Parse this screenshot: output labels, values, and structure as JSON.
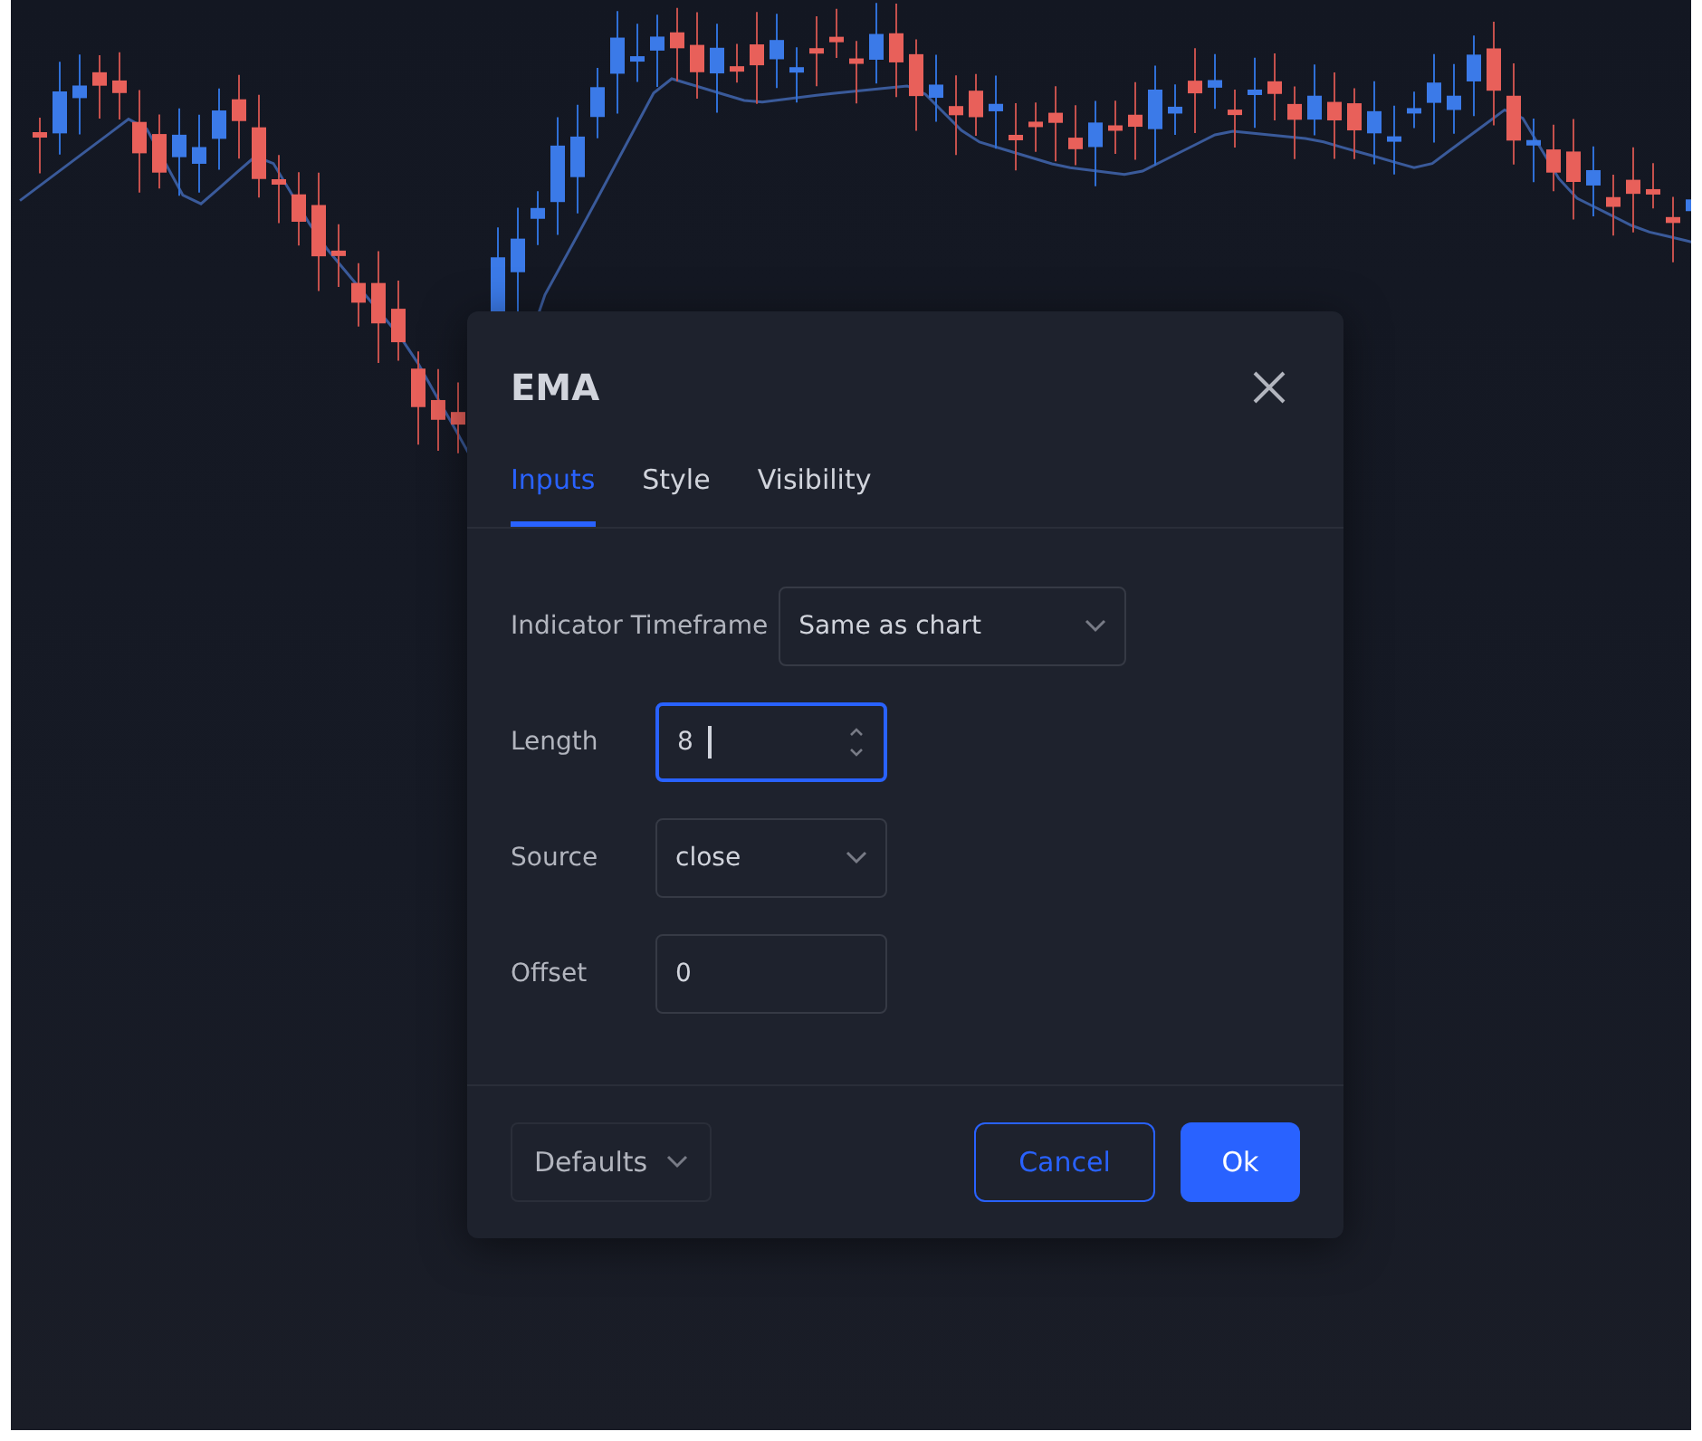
{
  "dialog": {
    "title": "EMA",
    "tabs": [
      {
        "label": "Inputs",
        "selected": true
      },
      {
        "label": "Style",
        "selected": false
      },
      {
        "label": "Visibility",
        "selected": false
      }
    ],
    "inputs": [
      {
        "kind": "select",
        "label": "Indicator Timeframe",
        "value": "Same as chart",
        "focused": false
      },
      {
        "kind": "number",
        "label": "Length",
        "value": "8",
        "focused": true
      },
      {
        "kind": "select",
        "label": "Source",
        "value": "close",
        "focused": false
      },
      {
        "kind": "text",
        "label": "Offset",
        "value": "0",
        "focused": false
      }
    ],
    "defaults": "Defaults",
    "buttons": [
      {
        "label": "Cancel",
        "kind": "secondary"
      },
      {
        "label": "Ok",
        "kind": "primary"
      }
    ]
  }
}
